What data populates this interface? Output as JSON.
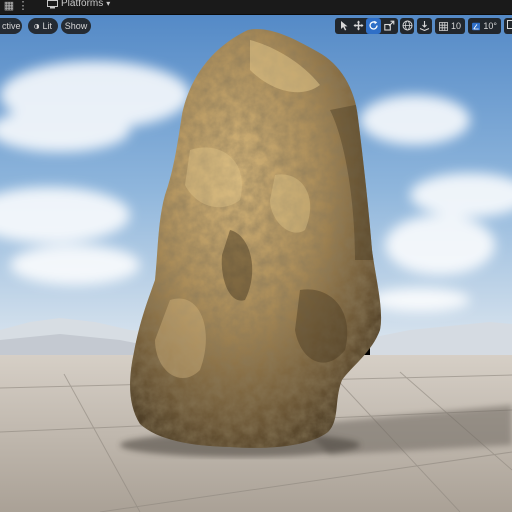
{
  "topbar": {
    "platforms_label": "Platforms",
    "menu_icon": "grid-icon",
    "more_icon": "vertical-dots-icon",
    "platforms_icon": "platforms-icon"
  },
  "viewport_options": {
    "mode_label": "ctive",
    "lit_label": "Lit",
    "show_label": "Show"
  },
  "transform_tools": {
    "select_icon": "select-arrow-icon",
    "translate_icon": "move-icon",
    "rotate_icon": "rotate-icon",
    "scale_icon": "scale-icon",
    "world_icon": "world-icon",
    "surface_snap_icon": "surface-snap-icon",
    "grid_snap_value": "10",
    "rotation_snap_value": "10°"
  },
  "colors": {
    "toolbar_bg": "#1a1a1a",
    "active_blue": "#2f6fc7",
    "sky_top": "#4f86c5",
    "floor": "#b9b2a8"
  }
}
